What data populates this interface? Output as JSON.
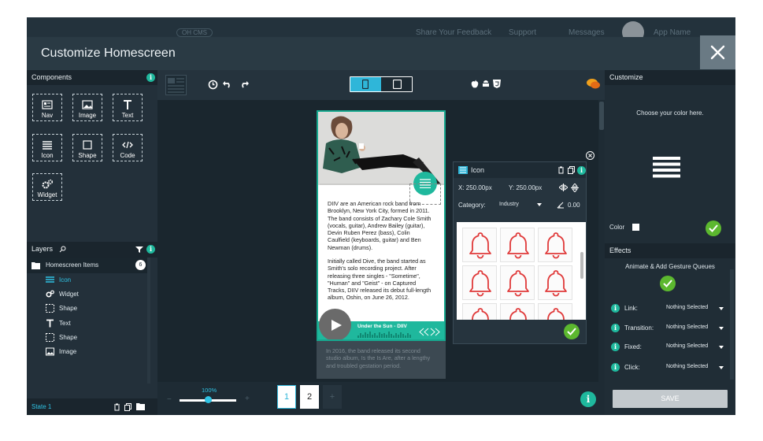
{
  "topbar": {
    "logo": "OH CMS",
    "feedback": "Share Your Feedback",
    "support": "Support",
    "messages": "Messages",
    "user": "App Name"
  },
  "header": {
    "title": "Customize Homescreen"
  },
  "components": {
    "title": "Components",
    "items": [
      {
        "label": "Nav",
        "icon": "nav-icon"
      },
      {
        "label": "Image",
        "icon": "image-icon"
      },
      {
        "label": "Text",
        "icon": "text-icon"
      },
      {
        "label": "Icon",
        "icon": "list-icon"
      },
      {
        "label": "Shape",
        "icon": "shape-icon"
      },
      {
        "label": "Code",
        "icon": "code-icon"
      },
      {
        "label": "Widget",
        "icon": "gears-icon"
      }
    ]
  },
  "layers": {
    "title": "Layers",
    "group": "Homescreen Items",
    "count": "6",
    "items": [
      {
        "label": "Icon",
        "icon": "list-icon",
        "selected": true
      },
      {
        "label": "Widget",
        "icon": "gears-icon"
      },
      {
        "label": "Shape",
        "icon": "shape-icon"
      },
      {
        "label": "Text",
        "icon": "text-icon"
      },
      {
        "label": "Shape",
        "icon": "shape-icon"
      },
      {
        "label": "Image",
        "icon": "image-icon"
      }
    ],
    "state": "State 1"
  },
  "phone": {
    "paragraph1": "DIIV are an American rock band from Brooklyn, New York City, formed in 2011. The band consists of Zachary Cole Smith (vocals, guitar), Andrew Bailey (guitar), Devin Ruben Perez (bass), Colin Caulfield (keyboards, guitar) and Ben Newman (drums).",
    "paragraph2": "Initially called Dive, the band started as Smith's solo recording project. After releasing three singles - \"Sometime\", \"Human\" and \"Geist\" - on Captured Tracks, DIIV released its debut full-length album, Oshin, on June 26, 2012.",
    "player_title": "Under the Sun - DIIV",
    "below": "In 2016, the band released its second studio album, Is the Is Are, after a lengthy and troubled gestation period."
  },
  "icon_panel": {
    "title": "Icon",
    "x": "X: 250.00px",
    "y": "Y: 250.00px",
    "category_label": "Category:",
    "category_value": "Industry",
    "angle": "0.00"
  },
  "zoom": {
    "value": "100%",
    "level": 0.5
  },
  "pages": [
    "1",
    "2"
  ],
  "customize": {
    "title": "Customize",
    "choose_text": "Choose your color here.",
    "color_label": "Color"
  },
  "effects": {
    "title": "Effects",
    "animate": "Animate & Add Gesture Queues",
    "rows": [
      {
        "label": "Link:",
        "value": "Nothing Selected"
      },
      {
        "label": "Transition:",
        "value": "Nothing Selected"
      },
      {
        "label": "Fixed:",
        "value": "Nothing Selected"
      },
      {
        "label": "Click:",
        "value": "Nothing Selected"
      }
    ],
    "save": "SAVE"
  },
  "colors": {
    "accent": "#1fb89d",
    "bell": "#e03a3a"
  }
}
